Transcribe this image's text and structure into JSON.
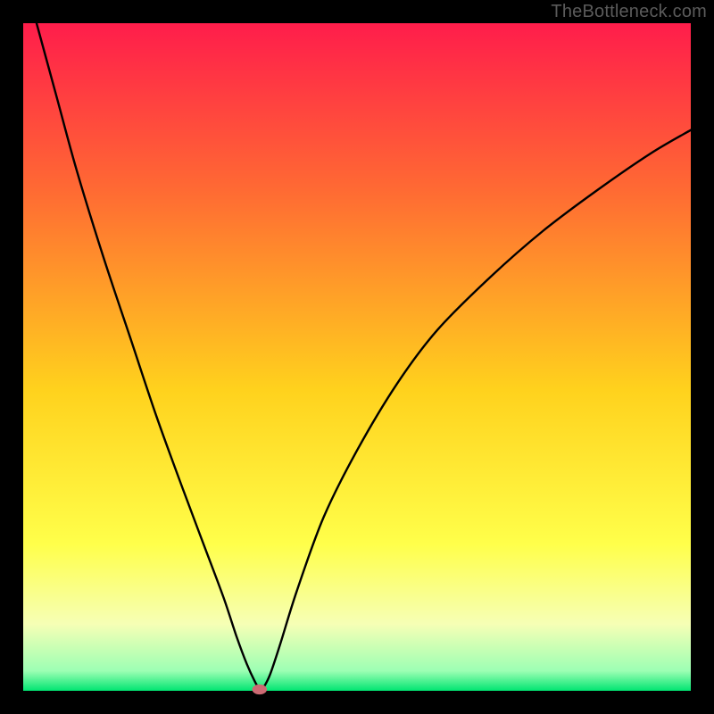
{
  "watermark": "TheBottleneck.com",
  "chart_data": {
    "type": "line",
    "title": "",
    "xlabel": "",
    "ylabel": "",
    "xlim": [
      0,
      100
    ],
    "ylim": [
      0,
      100
    ],
    "grid": false,
    "legend": false,
    "background": {
      "frame": "#000000",
      "gradient_stops": [
        {
          "y_pct": 0,
          "color": "#ff1d4b"
        },
        {
          "y_pct": 25,
          "color": "#ff6a33"
        },
        {
          "y_pct": 55,
          "color": "#ffd21d"
        },
        {
          "y_pct": 78,
          "color": "#ffff4a"
        },
        {
          "y_pct": 90,
          "color": "#f6ffb5"
        },
        {
          "y_pct": 97,
          "color": "#9dffb4"
        },
        {
          "y_pct": 100,
          "color": "#00e571"
        }
      ]
    },
    "series": [
      {
        "name": "bottleneck-curve",
        "color": "#000000",
        "x": [
          2,
          5,
          8,
          12,
          16,
          20,
          24,
          27,
          30,
          32,
          33.5,
          34.8,
          35.5,
          36,
          37,
          38.5,
          41,
          45,
          50,
          56,
          62,
          70,
          78,
          86,
          94,
          100
        ],
        "y": [
          100,
          89,
          78,
          65,
          53,
          41,
          30,
          22,
          14,
          8,
          4,
          1.2,
          0.2,
          0.5,
          2.5,
          7,
          15,
          26,
          36,
          46,
          54,
          62,
          69,
          75,
          80.5,
          84
        ]
      }
    ],
    "marker": {
      "name": "bottleneck-point",
      "x": 35.4,
      "y": 0.2,
      "rx_pct": 1.1,
      "ry_pct": 0.75,
      "color": "#cc6a73"
    }
  }
}
